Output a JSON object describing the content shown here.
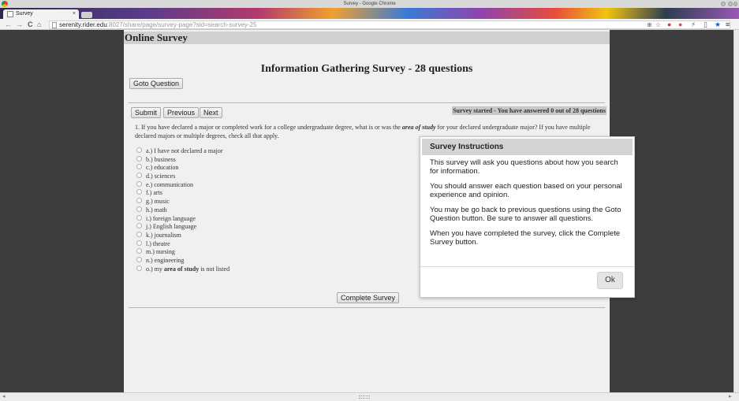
{
  "window": {
    "title": "Survey - Google Chrome"
  },
  "tab": {
    "label": "Survey",
    "close": "×"
  },
  "toolbar": {
    "back": "←",
    "forward": "→",
    "reload": "C",
    "home": "⌂",
    "url_host": "serenity.rider.edu",
    "url_rest": ":8027/share/page/survey-page?sid=search-survey-25"
  },
  "page": {
    "header": "Online Survey",
    "survey_title": "Information Gathering Survey - 28 questions",
    "goto_button": "Goto Question",
    "submit_button": "Submit",
    "previous_button": "Previous",
    "next_button": "Next",
    "status": "Survey started - You have answered 0 out of 28 questions",
    "question_pre": "1. If you have declared a major or completed work for a college undergraduate degree, what is or was the ",
    "question_emph": "area of study",
    "question_post": " for your declared undergraduate major? If you have multiple declared majors or multiple degrees, check all that apply.",
    "options": [
      "a.) I have not declared a major",
      "b.) business",
      "c.) education",
      "d.) sciences",
      "e.) communication",
      "f.) arts",
      "g.) music",
      "h.) math",
      "i.) foreign language",
      "j.) English language",
      "k.) journalism",
      "l.) theatre",
      "m.) nursing",
      "n.) engineering"
    ],
    "last_option_pre": "o.) my ",
    "last_option_emph": "area of study",
    "last_option_post": " is not listed",
    "complete_button": "Complete Survey"
  },
  "dialog": {
    "title": "Survey Instructions",
    "paragraphs": [
      "This survey will ask you questions about how you search for information.",
      "You should answer each question based on your personal experience and opinion.",
      "You may be go back to previous questions using the Goto Question button. Be sure to answer all questions.",
      "When you have completed the survey, click the Complete Survey button."
    ],
    "ok_button": "Ok"
  }
}
